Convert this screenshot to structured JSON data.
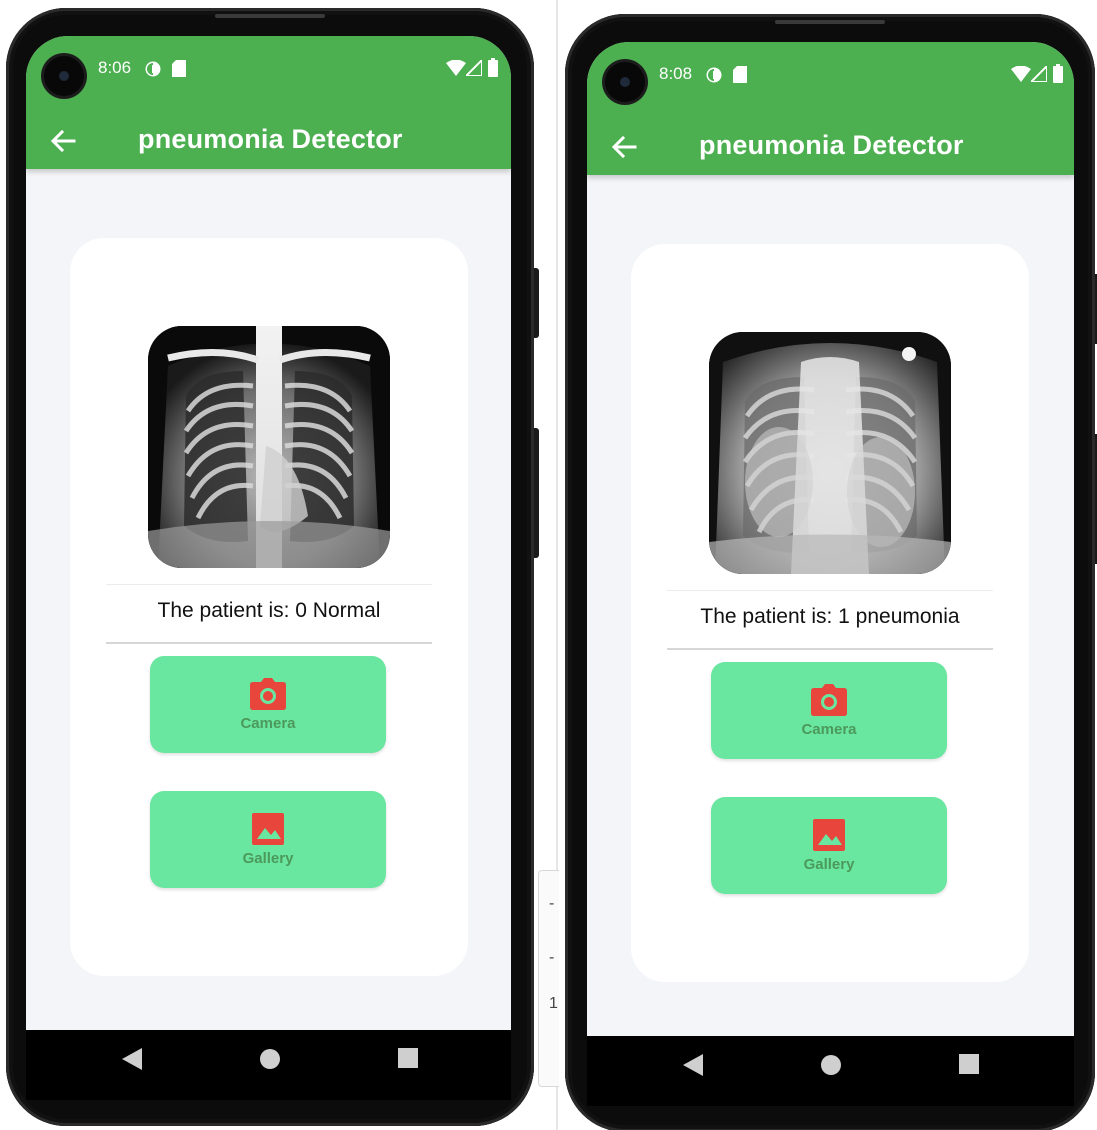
{
  "colors": {
    "app_bar": "#4caf50",
    "button_fill": "#69e69f",
    "button_label": "#4c9a5b",
    "icon_red": "#e8453c",
    "screen_bg": "#f4f5f8"
  },
  "left_phone": {
    "status": {
      "time": "8:06",
      "icons": [
        "sync-icon",
        "sd-card-icon",
        "wifi-icon",
        "signal-icon",
        "battery-icon"
      ]
    },
    "app_bar": {
      "title": "pneumonia Detector",
      "back_icon": "arrow-back-icon"
    },
    "result": {
      "text": "The patient is: 0 Normal"
    },
    "buttons": {
      "camera_label": "Camera",
      "gallery_label": "Gallery"
    },
    "nav": [
      "back-triangle-icon",
      "home-circle-icon",
      "recents-square-icon"
    ]
  },
  "right_phone": {
    "status": {
      "time": "8:08",
      "icons": [
        "sync-icon",
        "sd-card-icon",
        "wifi-icon",
        "signal-icon",
        "battery-icon"
      ]
    },
    "app_bar": {
      "title": "pneumonia Detector",
      "back_icon": "arrow-back-icon"
    },
    "result": {
      "text": "The patient is: 1 pneumonia"
    },
    "buttons": {
      "camera_label": "Camera",
      "gallery_label": "Gallery"
    },
    "nav": [
      "back-triangle-icon",
      "home-circle-icon",
      "recents-square-icon"
    ]
  },
  "edge_fragment": {
    "glyphs": [
      "-",
      "-",
      "1"
    ]
  }
}
